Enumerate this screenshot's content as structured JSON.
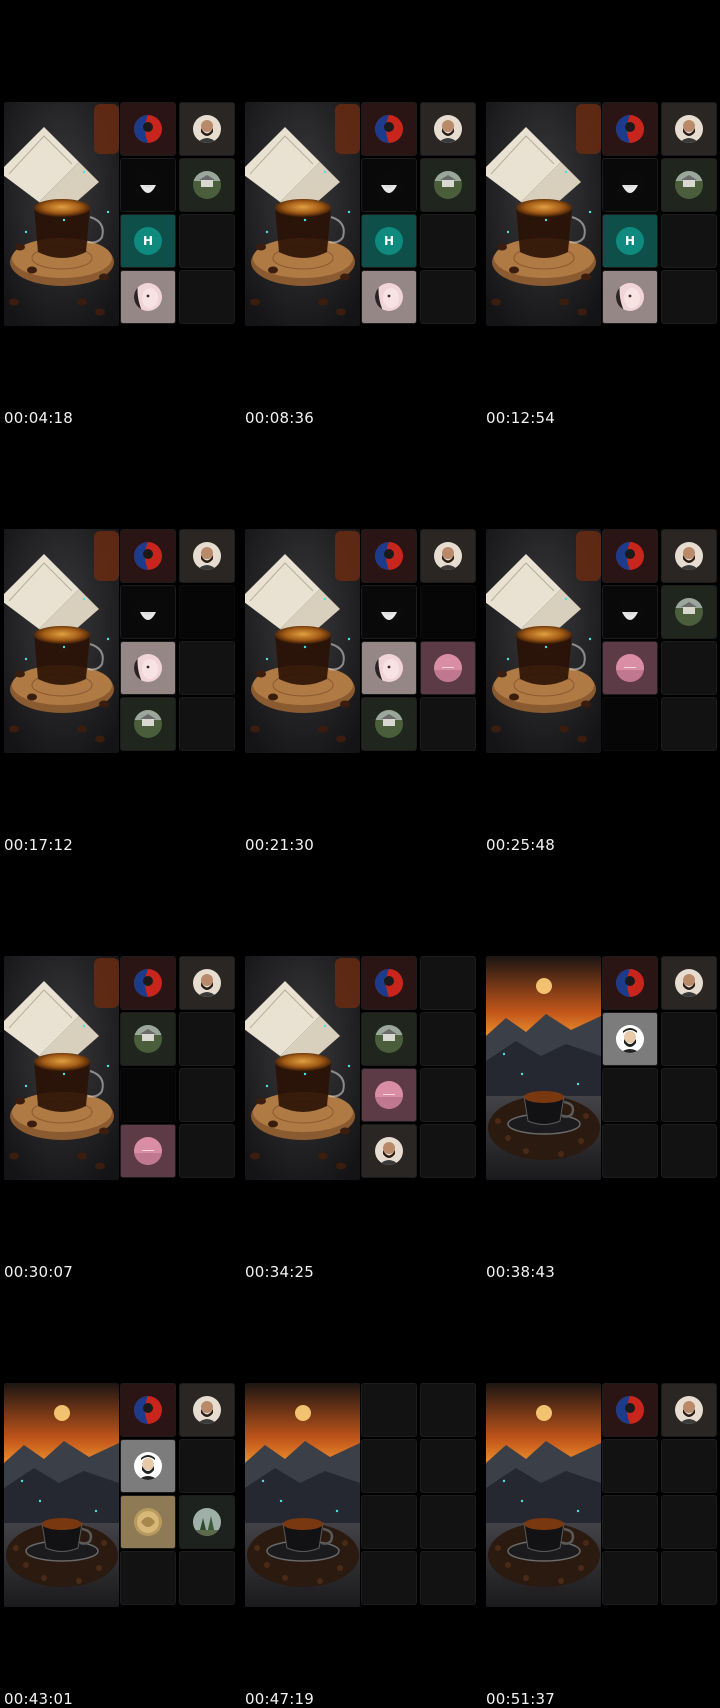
{
  "frames": [
    {
      "timestamp": "00:04:18",
      "scene": "book-coffee",
      "tiles": [
        "red-blue-avatar",
        "bearded-man-avatar",
        "dark-figure-avatar",
        "landscape-avatar",
        "letter-avatar",
        "",
        "pink-face-avatar",
        ""
      ]
    },
    {
      "timestamp": "00:08:36",
      "scene": "book-coffee",
      "tiles": [
        "red-blue-avatar",
        "bearded-man-avatar",
        "dark-figure-avatar",
        "landscape-avatar",
        "letter-avatar",
        "",
        "pink-face-avatar",
        ""
      ]
    },
    {
      "timestamp": "00:12:54",
      "scene": "book-coffee",
      "tiles": [
        "red-blue-avatar",
        "bearded-man-avatar",
        "dark-figure-avatar",
        "landscape-avatar",
        "letter-avatar",
        "",
        "pink-face-avatar",
        ""
      ]
    },
    {
      "timestamp": "00:17:12",
      "scene": "book-coffee",
      "tiles": [
        "red-blue-avatar",
        "bearded-man-avatar",
        "dark-figure-avatar",
        "blank",
        "pink-face-avatar",
        "",
        "landscape-avatar",
        ""
      ]
    },
    {
      "timestamp": "00:21:30",
      "scene": "book-coffee",
      "tiles": [
        "red-blue-avatar",
        "bearded-man-avatar",
        "dark-figure-avatar",
        "blank",
        "pink-face-avatar",
        "pink-sunset-avatar",
        "landscape-avatar",
        ""
      ]
    },
    {
      "timestamp": "00:25:48",
      "scene": "book-coffee",
      "tiles": [
        "red-blue-avatar",
        "bearded-man-avatar",
        "dark-figure-avatar",
        "landscape-avatar",
        "pink-sunset-avatar",
        "",
        "blank",
        ""
      ]
    },
    {
      "timestamp": "00:30:07",
      "scene": "book-coffee",
      "tiles": [
        "red-blue-avatar",
        "bearded-man-avatar",
        "landscape-avatar",
        "",
        "blank",
        "",
        "pink-sunset-avatar",
        ""
      ]
    },
    {
      "timestamp": "00:34:25",
      "scene": "book-coffee",
      "tiles": [
        "red-blue-avatar",
        "",
        "landscape-avatar",
        "",
        "pink-sunset-avatar",
        "",
        "bearded-man-avatar",
        ""
      ]
    },
    {
      "timestamp": "00:38:43",
      "scene": "sunset-coffee",
      "tiles": [
        "red-blue-avatar",
        "bearded-man-avatar",
        "cartoon-beard-avatar",
        "",
        "",
        "",
        "",
        ""
      ]
    },
    {
      "timestamp": "00:43:01",
      "scene": "sunset-coffee",
      "tiles": [
        "red-blue-avatar",
        "bearded-man-avatar",
        "cartoon-beard-avatar",
        "",
        "gold-ornament-avatar",
        "forest-avatar",
        "",
        ""
      ]
    },
    {
      "timestamp": "00:47:19",
      "scene": "sunset-coffee",
      "tiles": [
        "",
        "",
        "",
        "",
        "",
        "",
        "",
        ""
      ]
    },
    {
      "timestamp": "00:51:37",
      "scene": "sunset-coffee",
      "tiles": [
        "red-blue-avatar",
        "bearded-man-avatar",
        "",
        "",
        "",
        "",
        "",
        ""
      ]
    }
  ],
  "letter_avatar": {
    "letter": "H",
    "color": "#0f8a7e"
  },
  "colors": {
    "background": "#000000",
    "tile": "#121212",
    "teal": "#0f8a7e"
  }
}
